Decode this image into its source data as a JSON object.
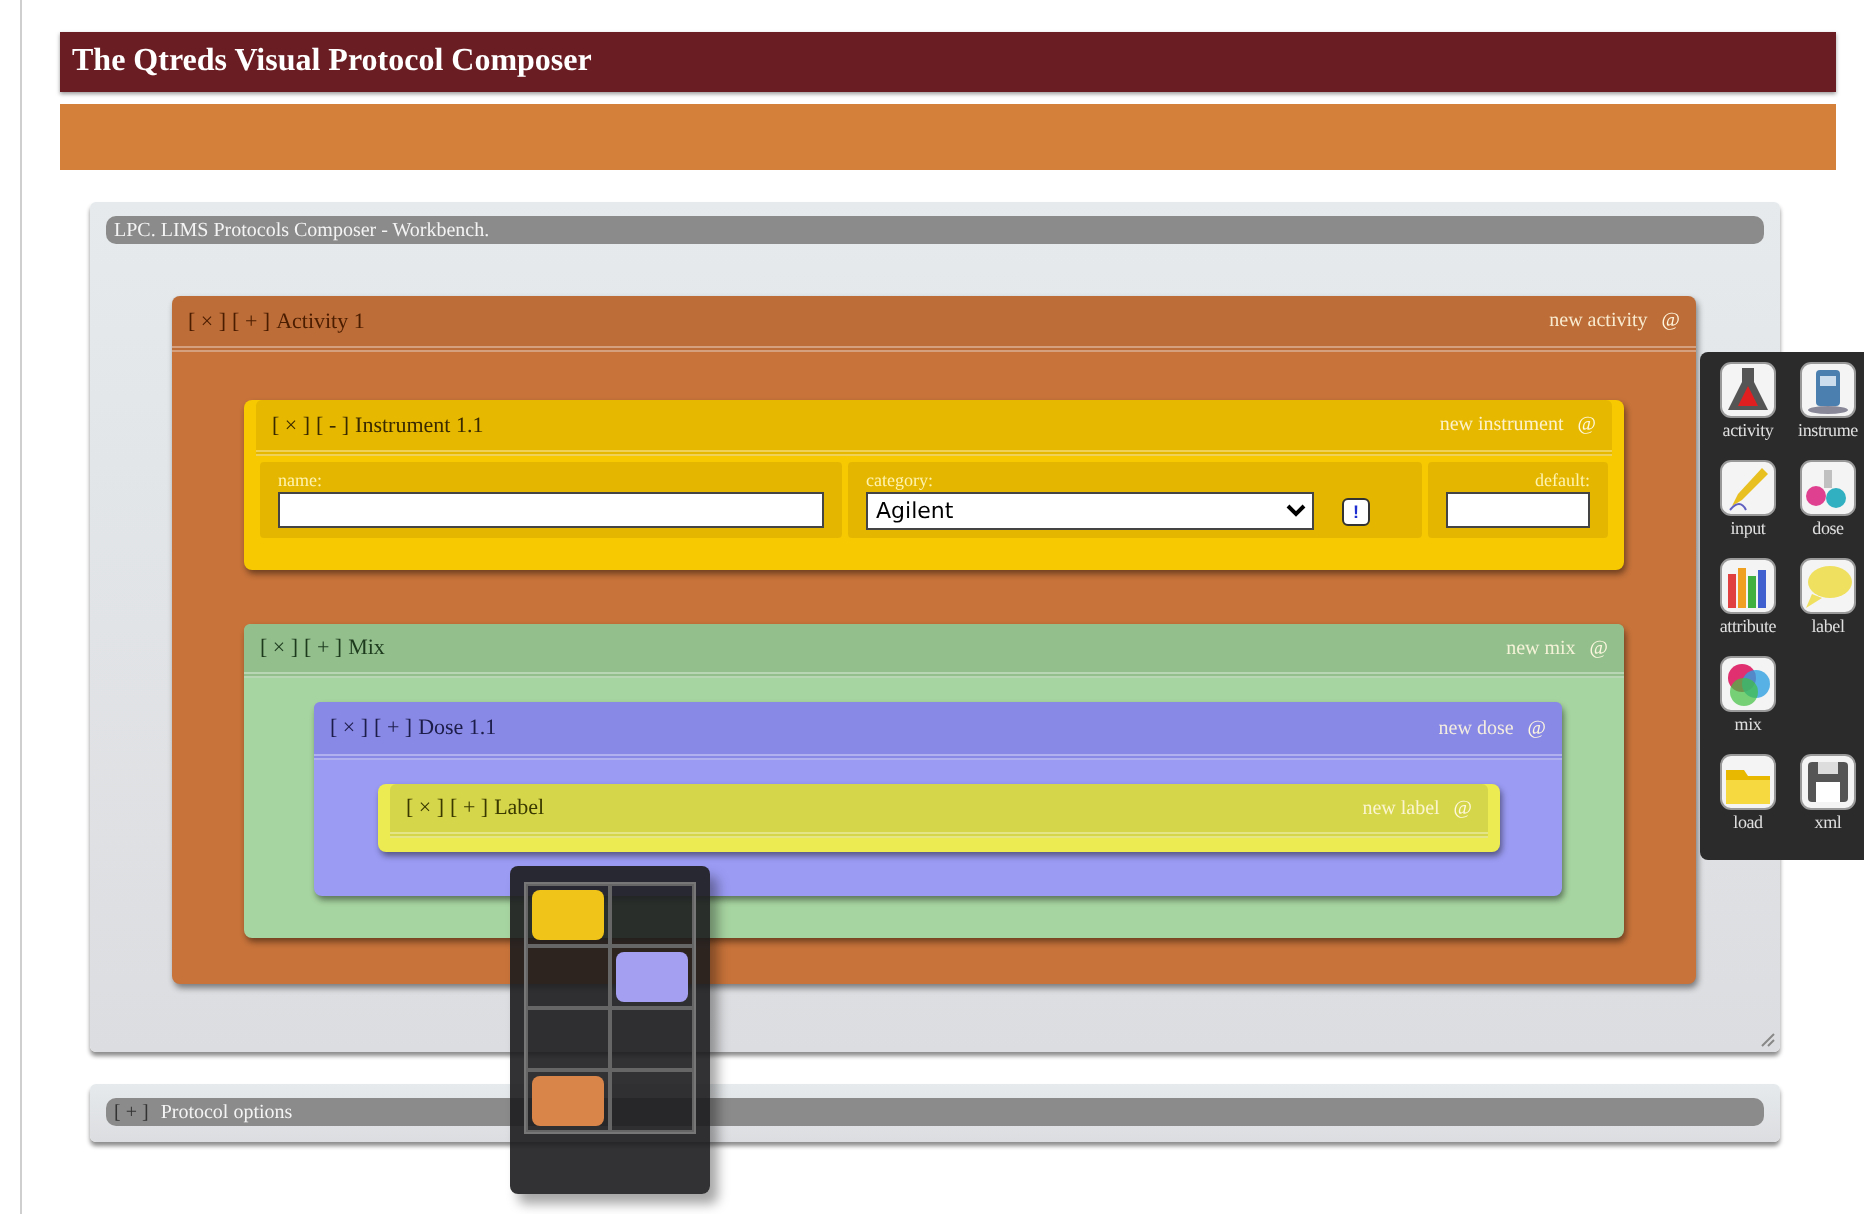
{
  "header": {
    "title": "The Qtreds Visual Protocol Composer"
  },
  "workbench": {
    "title": "LPC. LIMS Protocols Composer - Workbench.",
    "blocks": [
      {
        "kind": "activity",
        "close": "[ × ]",
        "toggle": "[ + ]",
        "title": "Activity 1",
        "add_label": "new activity",
        "add_icon": "@",
        "children": [
          {
            "kind": "instrument",
            "close": "[ × ]",
            "toggle": "[ - ]",
            "title": "Instrument 1.1",
            "add_label": "new instrument",
            "add_icon": "@",
            "fields": {
              "name_label": "name:",
              "category_label": "category:",
              "category_value": "Agilent",
              "info_button": "!",
              "default_label": "default:"
            }
          },
          {
            "kind": "mix",
            "close": "[ × ]",
            "toggle": "[ + ]",
            "title": "Mix",
            "add_label": "new mix",
            "add_icon": "@",
            "children": [
              {
                "kind": "dose",
                "close": "[ × ]",
                "toggle": "[ + ]",
                "title": "Dose 1.1",
                "add_label": "new dose",
                "add_icon": "@",
                "children": [
                  {
                    "kind": "label",
                    "close": "[ × ]",
                    "toggle": "[ + ]",
                    "title": "Label",
                    "add_label": "new label",
                    "add_icon": "@"
                  }
                ]
              }
            ]
          }
        ]
      }
    ]
  },
  "protocol_options": {
    "toggle": "[ + ]",
    "title": "Protocol options"
  },
  "color_picker": {
    "cells": [
      {
        "kind": "swatch",
        "color": "#f0c419"
      },
      {
        "kind": "empty"
      },
      {
        "kind": "empty"
      },
      {
        "kind": "swatch",
        "color": "#a59ff2"
      },
      {
        "kind": "empty"
      },
      {
        "kind": "empty"
      },
      {
        "kind": "swatch",
        "color": "#d9854a"
      },
      {
        "kind": "empty"
      }
    ]
  },
  "palette": {
    "items": [
      {
        "kind": "activity",
        "label": "activity"
      },
      {
        "kind": "instrument",
        "label": "instrume"
      },
      {
        "kind": "input",
        "label": "input"
      },
      {
        "kind": "dose",
        "label": "dose"
      },
      {
        "kind": "attribute",
        "label": "attribute"
      },
      {
        "kind": "label",
        "label": "label"
      },
      {
        "kind": "mix",
        "label": "mix"
      },
      {
        "kind": "blank"
      },
      {
        "kind": "load",
        "label": "load"
      },
      {
        "kind": "xml",
        "label": "xml"
      }
    ]
  }
}
